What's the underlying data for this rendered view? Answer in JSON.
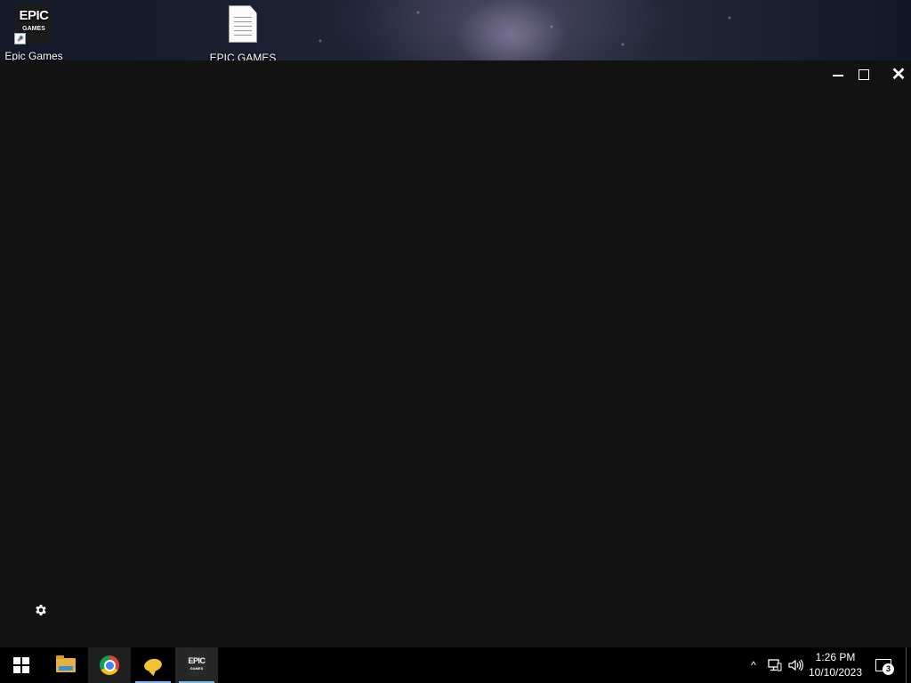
{
  "desktop": {
    "icons": [
      {
        "label": "Epic Games",
        "icon": "epic-games-logo",
        "logo_line1": "EPIC",
        "logo_line2": "GAMES",
        "shortcut_icon": "shortcut-arrow-icon"
      },
      {
        "label": "EPIC GAMES",
        "icon": "text-document-icon"
      }
    ]
  },
  "window": {
    "background": "#121212",
    "controls": {
      "minimize_icon": "minimize-icon",
      "maximize_icon": "maximize-icon",
      "close_icon": "close-icon",
      "close_glyph": "✕"
    },
    "settings_icon": "gear-icon"
  },
  "taskbar": {
    "items": [
      {
        "name": "start",
        "icon": "windows-logo-icon"
      },
      {
        "name": "file-explorer",
        "icon": "folder-icon"
      },
      {
        "name": "chrome",
        "icon": "chrome-icon",
        "state": "hovered"
      },
      {
        "name": "chat-app",
        "icon": "speech-bubble-icon",
        "state": "running"
      },
      {
        "name": "epic-games-launcher",
        "icon": "epic-games-logo",
        "logo_line1": "EPIC",
        "logo_line2": "GAMES",
        "state": "active"
      }
    ],
    "tray": {
      "chevron_glyph": "^",
      "network_icon": "network-icon",
      "volume_glyph": "🔊",
      "time": "1:26 PM",
      "date": "10/10/2023",
      "notification_count": "3"
    },
    "colors": {
      "background": "#000000",
      "running_indicator": "#76b9ed"
    }
  }
}
